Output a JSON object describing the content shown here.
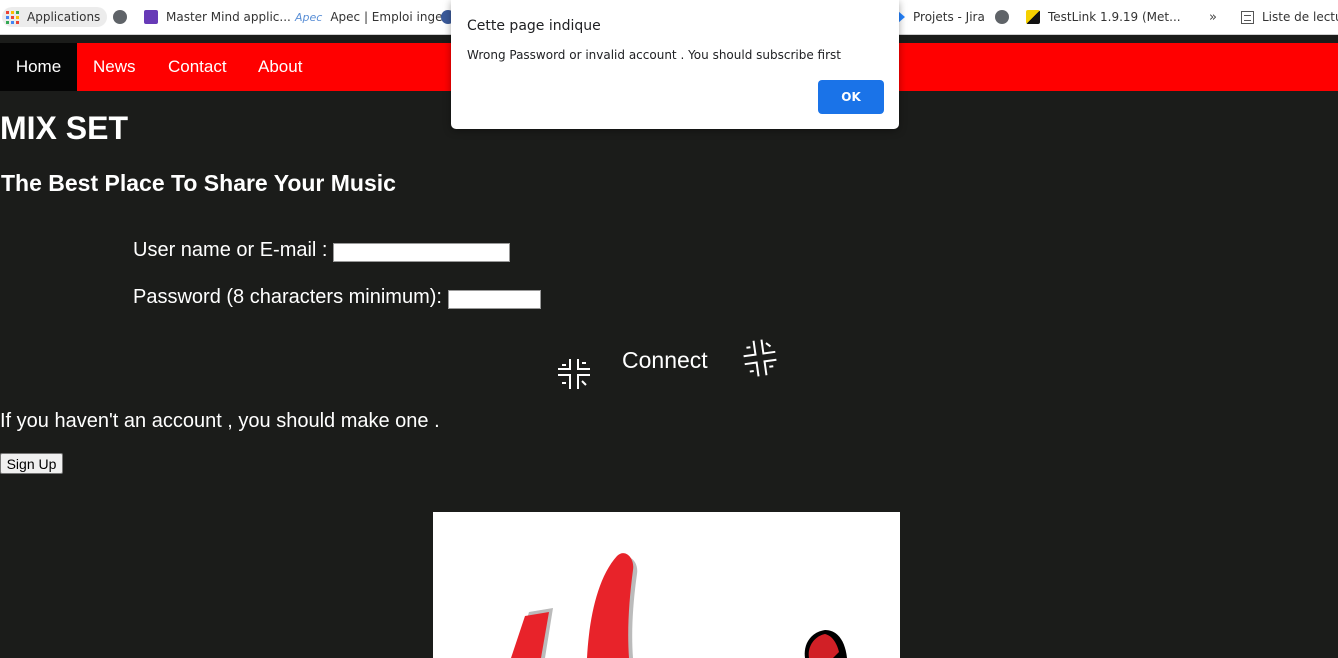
{
  "bookmarks": {
    "apps_label": "Applications",
    "items": [
      "Master Mind applic...",
      "Apec | Emploi inge...",
      "Projets - Jira",
      "TestLink 1.9.19 (Met..."
    ],
    "more": "»",
    "reading_list": "Liste de lectur",
    "apec_logo_text": "Apec"
  },
  "nav": {
    "items": [
      "Home",
      "News",
      "Contact",
      "About"
    ],
    "active": "Home",
    "colors": {
      "bar": "#ff0000",
      "active": "#050505"
    }
  },
  "page": {
    "title": "MIX SET",
    "subtitle": "The Best Place To Share Your Music",
    "background": "#1b1c1a"
  },
  "form": {
    "username_label": "User name or E-mail :",
    "username_value": "",
    "password_label": "Password (8 characters minimum):",
    "password_value": "",
    "connect_label": "Connect"
  },
  "signup": {
    "text": "If you haven't an account , you should make one .",
    "button_label": "Sign Up"
  },
  "dialog": {
    "title": "Cette page indique",
    "message": "Wrong Password or invalid account . You should subscribe first",
    "ok_label": "OK",
    "button_color": "#1a73e8"
  },
  "logo": {
    "name": "mix-set-logo"
  }
}
